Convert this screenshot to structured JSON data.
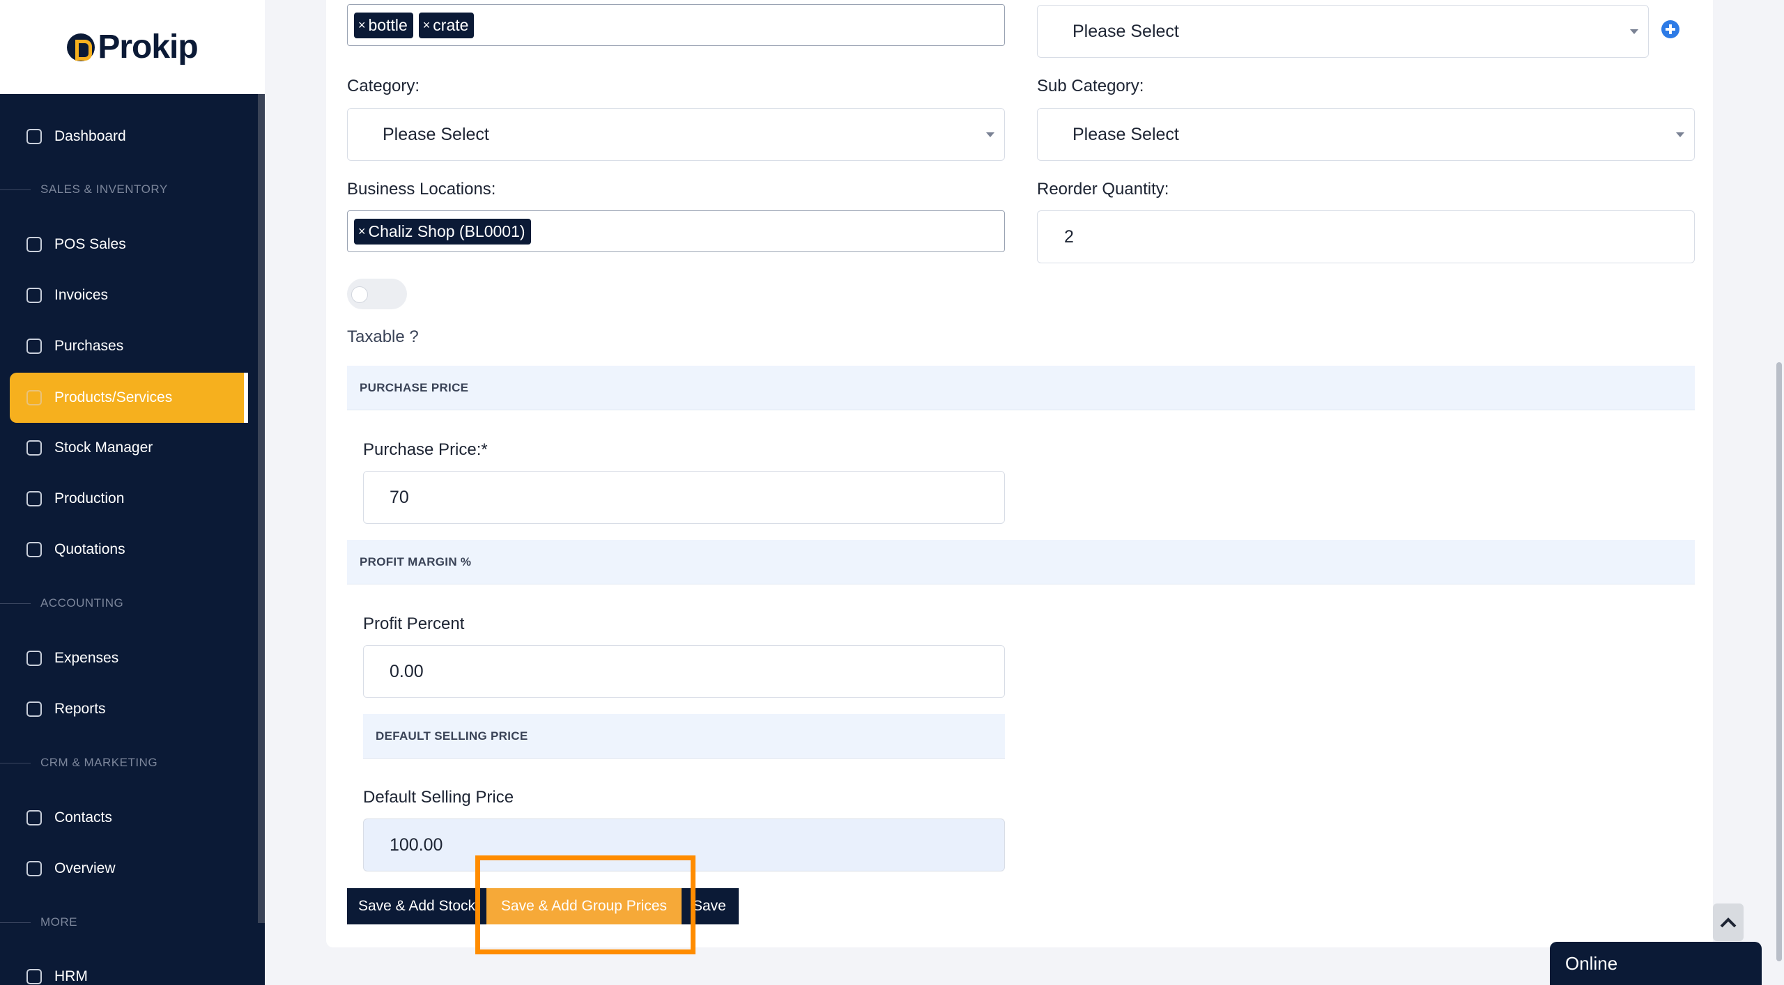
{
  "brand": {
    "logo_text": "Prokip"
  },
  "sidebar": {
    "items": [
      {
        "label": "Dashboard",
        "icon": "home-icon"
      },
      {
        "label": "POS Sales",
        "icon": "bag-icon"
      },
      {
        "label": "Invoices",
        "icon": "invoice-icon"
      },
      {
        "label": "Purchases",
        "icon": "box-icon"
      },
      {
        "label": "Products/Services",
        "icon": "package-icon",
        "active": true
      },
      {
        "label": "Stock Manager",
        "icon": "stock-icon"
      },
      {
        "label": "Production",
        "icon": "factory-icon"
      },
      {
        "label": "Quotations",
        "icon": "quote-icon"
      },
      {
        "label": "Expenses",
        "icon": "pie-icon"
      },
      {
        "label": "Reports",
        "icon": "presentation-icon"
      },
      {
        "label": "Contacts",
        "icon": "contacts-icon"
      },
      {
        "label": "Overview",
        "icon": "id-card-icon"
      },
      {
        "label": "HRM",
        "icon": "hrm-icon"
      }
    ],
    "sections": [
      "SALES & INVENTORY",
      "ACCOUNTING",
      "CRM & MARKETING",
      "MORE"
    ]
  },
  "form": {
    "units_tags": [
      "bottle",
      "crate"
    ],
    "top_right_select": "Please Select",
    "category": {
      "label": "Category:",
      "value": "Please Select"
    },
    "sub_category": {
      "label": "Sub Category:",
      "value": "Please Select"
    },
    "business_locations": {
      "label": "Business Locations:",
      "tags": [
        "Chaliz Shop (BL0001)"
      ]
    },
    "reorder_quantity": {
      "label": "Reorder Quantity:",
      "value": "2"
    },
    "taxable_label": "Taxable ?",
    "purchase_price_band": "PURCHASE PRICE",
    "purchase_price": {
      "label": "Purchase Price:*",
      "value": "70"
    },
    "profit_margin_band": "PROFIT MARGIN %",
    "profit_percent": {
      "label": "Profit Percent",
      "value": "0.00"
    },
    "default_selling_band": "DEFAULT SELLING PRICE",
    "default_selling_price": {
      "label": "Default Selling Price",
      "value": "100.00"
    }
  },
  "buttons": {
    "save_add_stock": "Save & Add Stock",
    "save_add_group_prices": "Save & Add Group Prices",
    "save": "Save"
  },
  "chat": {
    "status": "Online"
  },
  "colors": {
    "sidebar": "#0b1a36",
    "accent": "#f6b01e",
    "highlight": "#ff8c00"
  }
}
